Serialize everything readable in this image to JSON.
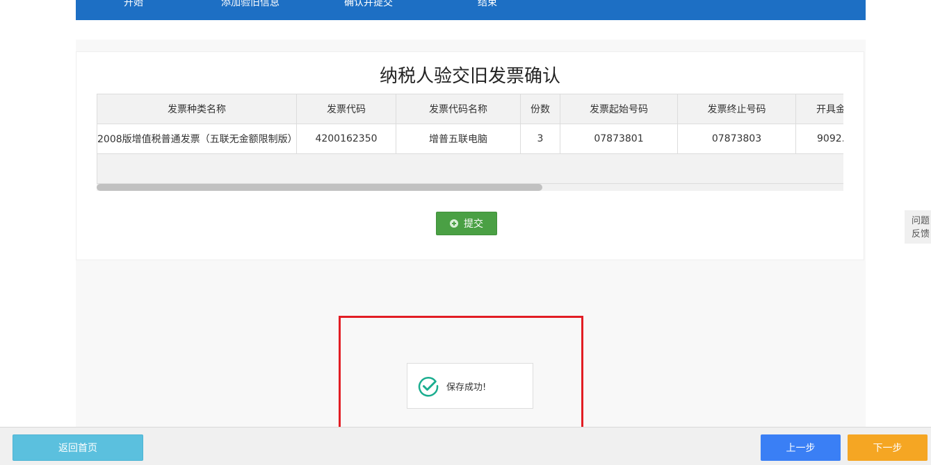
{
  "steps": [
    "开始",
    "添加验旧信息",
    "确认并提交",
    "结束"
  ],
  "page_title": "纳税人验交旧发票确认",
  "table": {
    "headers": [
      "发票种类名称",
      "发票代码",
      "发票代码名称",
      "份数",
      "发票起始号码",
      "发票终止号码",
      "开具金额"
    ],
    "rows": [
      [
        "2008版增值税普通发票（五联无金额限制版）",
        "4200162350",
        "增普五联电脑",
        "3",
        "07873801",
        "07873803",
        "9092."
      ]
    ]
  },
  "submit_label": "提交",
  "feedback": {
    "line1": "问题",
    "line2": "反馈"
  },
  "toast": {
    "message": "保存成功!",
    "icon": "check-circle-icon"
  },
  "bottom": {
    "home": "返回首页",
    "prev": "上一步",
    "next": "下一步"
  },
  "colors": {
    "stepbar": "#1d6fc4",
    "submit": "#4aa044",
    "home": "#5bc0de",
    "prev": "#3a7ff5",
    "next": "#f5a623",
    "highlight": "#e21d24",
    "check": "#1aad8f"
  }
}
